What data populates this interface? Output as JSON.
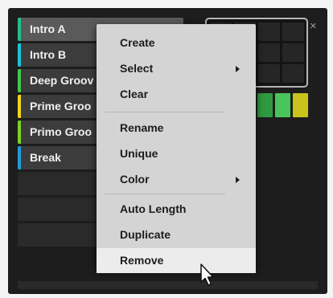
{
  "scenes": [
    {
      "label": "Intro A",
      "color": "#22c08a",
      "active": true
    },
    {
      "label": "Intro B",
      "color": "#17c5d6"
    },
    {
      "label": "Deep Groov",
      "color": "#44c84b"
    },
    {
      "label": "Prime Groo",
      "color": "#f1d31b"
    },
    {
      "label": "Primo Groo",
      "color": "#7ed321"
    },
    {
      "label": "Break",
      "color": "#1e9ee0"
    }
  ],
  "close_icon_glyph": "×",
  "grid": {
    "rows": 3,
    "cols": 4
  },
  "color_strip": [
    "#2f9a3f",
    "#4ac55c",
    "#c9c31c"
  ],
  "context_menu": {
    "items": [
      {
        "label": "Create"
      },
      {
        "label": "Select",
        "has_submenu": true
      },
      {
        "label": "Clear"
      },
      {
        "label": "Rename"
      },
      {
        "label": "Unique"
      },
      {
        "label": "Color",
        "has_submenu": true
      },
      {
        "label": "Auto Length"
      },
      {
        "label": "Duplicate"
      },
      {
        "label": "Remove",
        "hovered": true
      }
    ]
  },
  "icons": {
    "close": "close-icon",
    "submenu": "chevron-right-icon",
    "cursor": "mouse-pointer-icon"
  }
}
